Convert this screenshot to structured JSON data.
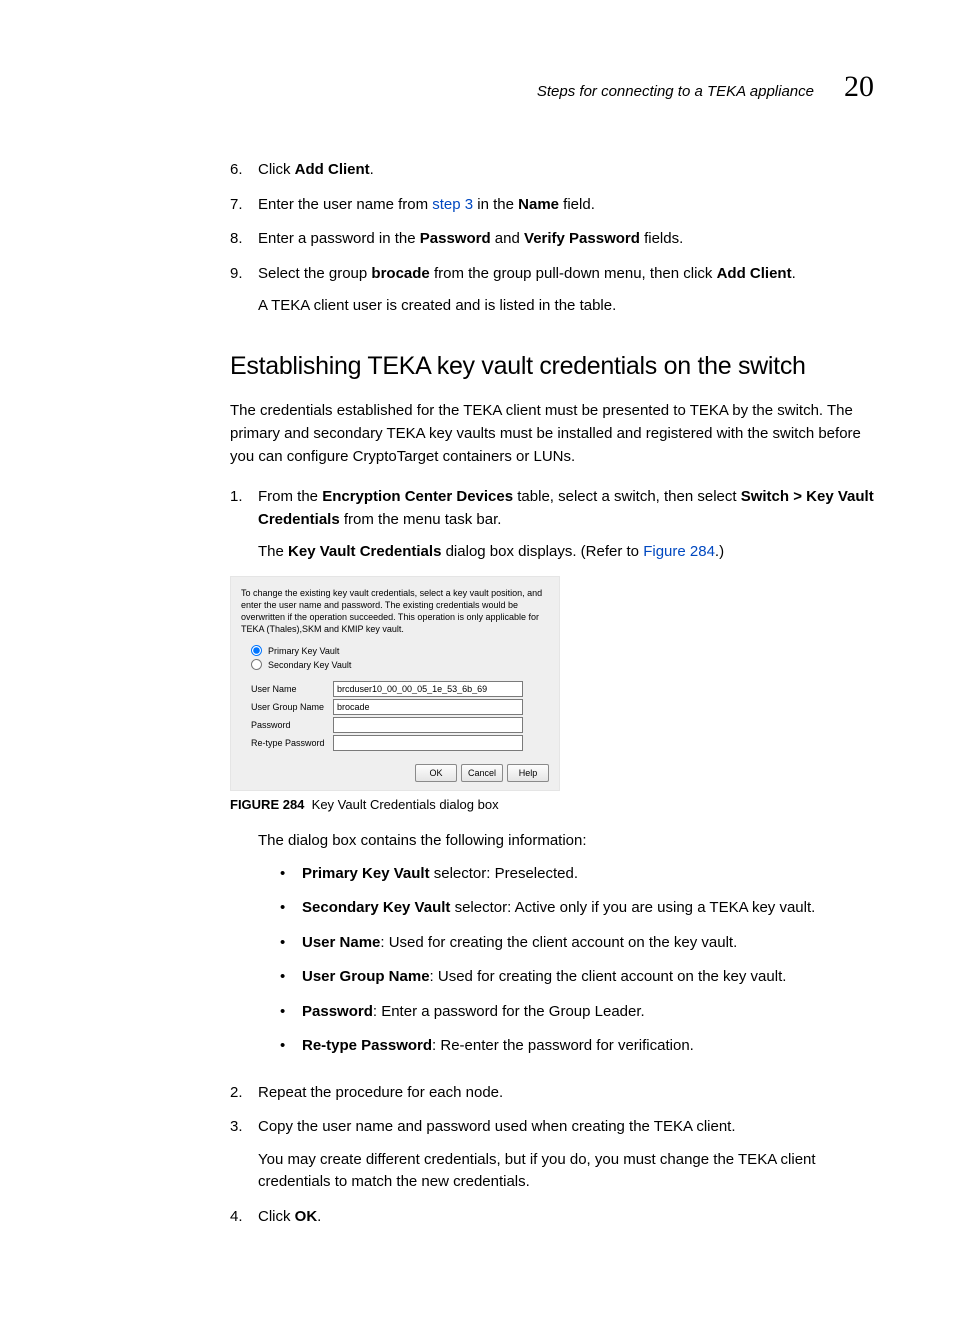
{
  "header": {
    "running_title": "Steps for connecting to a TEKA appliance",
    "chapter_number": "20"
  },
  "steps_a": [
    {
      "n": "6.",
      "pre": "Click ",
      "b": "Add Client",
      "post": "."
    },
    {
      "n": "7.",
      "pre": "Enter the user name from ",
      "link": "step 3",
      "mid": " in the ",
      "b": "Name",
      "post": " field."
    },
    {
      "n": "8.",
      "pre": "Enter a password in the ",
      "b": "Password",
      "mid": " and ",
      "b2": "Verify Password",
      "post": " fields."
    },
    {
      "n": "9.",
      "pre": "Select the group ",
      "b": "brocade",
      "mid": " from the group pull-down menu, then click ",
      "b2": "Add Client",
      "post": ".",
      "after": "A TEKA client user is created and is listed in the table."
    }
  ],
  "h2": "Establishing TEKA key vault credentials on the switch",
  "intro": "The credentials established for the TEKA client must be presented to TEKA by the switch. The primary and secondary TEKA key vaults must be installed and registered with the switch before you can configure CryptoTarget containers or LUNs.",
  "steps_b1": {
    "n": "1.",
    "pre": "From the ",
    "b": "Encryption Center Devices",
    "mid": " table, select a switch, then select ",
    "b2": "Switch > Key Vault Credentials",
    "post": " from the menu task bar.",
    "after_pre": "The ",
    "after_b": "Key Vault Credentials",
    "after_mid": " dialog box displays. (Refer to ",
    "after_link": "Figure 284",
    "after_post": ".)"
  },
  "dialog": {
    "intro": "To change the existing key vault credentials, select a key vault position, and enter the user name and password. The existing credentials would be overwritten if the operation succeeded. This operation is only applicable for TEKA (Thales),SKM and KMIP key vault.",
    "radio1": "Primary Key Vault",
    "radio2": "Secondary Key Vault",
    "fields": {
      "user_name_label": "User Name",
      "user_name_value": "brcduser10_00_00_05_1e_53_6b_69",
      "user_group_label": "User Group Name",
      "user_group_value": "brocade",
      "password_label": "Password",
      "retype_label": "Re-type Password"
    },
    "buttons": {
      "ok": "OK",
      "cancel": "Cancel",
      "help": "Help"
    }
  },
  "figcap": {
    "label": "FIGURE 284",
    "text": "Key Vault Credentials dialog box"
  },
  "after_fig": "The dialog box contains the following information:",
  "bullets": [
    {
      "b": "Primary Key Vault",
      "t": " selector: Preselected."
    },
    {
      "b": "Secondary Key Vault",
      "t": " selector: Active only if you are using a TEKA key vault."
    },
    {
      "b": "User Name",
      "t": ": Used for creating the client account on the key vault."
    },
    {
      "b": "User Group Name",
      "t": ": Used for creating the client account on the key vault."
    },
    {
      "b": "Password",
      "t": ": Enter a password for the Group Leader."
    },
    {
      "b": "Re-type Password",
      "t": ": Re-enter the password for verification."
    }
  ],
  "steps_c": [
    {
      "n": "2.",
      "text": "Repeat the procedure for each node."
    },
    {
      "n": "3.",
      "text": "Copy the user name and password used when creating the TEKA client.",
      "after": "You may create different credentials, but if you do, you must change the TEKA client credentials to match the new credentials."
    },
    {
      "n": "4.",
      "pre": "Click ",
      "b": "OK",
      "post": "."
    }
  ]
}
